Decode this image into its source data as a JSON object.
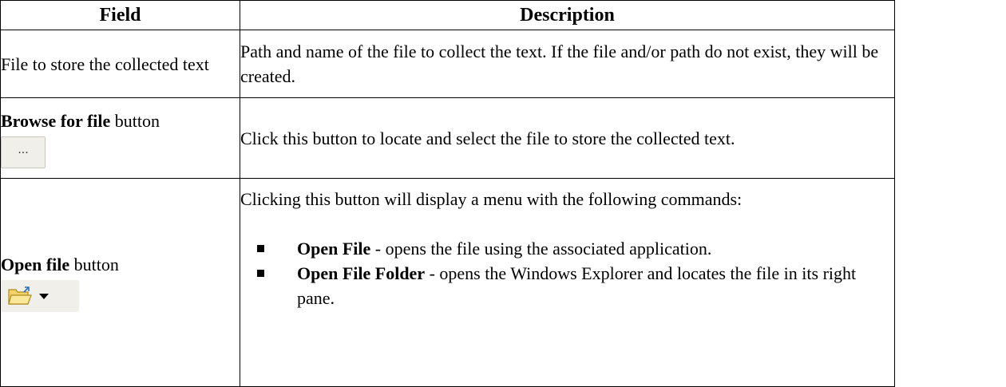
{
  "table": {
    "headers": {
      "field": "Field",
      "description": "Description"
    },
    "rows": [
      {
        "field": "File to store the collected text",
        "description": "Path and name of the file to collect the text. If the file and/or path do not exist, they will be created."
      },
      {
        "field_bold": "Browse for file",
        "field_suffix": " button",
        "button_label": "...",
        "description": "Click this button to locate and select the file to store the collected text."
      },
      {
        "field_bold": "Open file",
        "field_suffix": " button",
        "button_icon": "folder-open-icon",
        "description_intro": "Clicking this button will display a menu with the following commands:",
        "commands": [
          {
            "name": "Open File",
            "text": " - opens the file using the associated application."
          },
          {
            "name": "Open File Folder",
            "text": " - opens the Windows Explorer and locates the file in its right pane."
          }
        ]
      }
    ]
  }
}
